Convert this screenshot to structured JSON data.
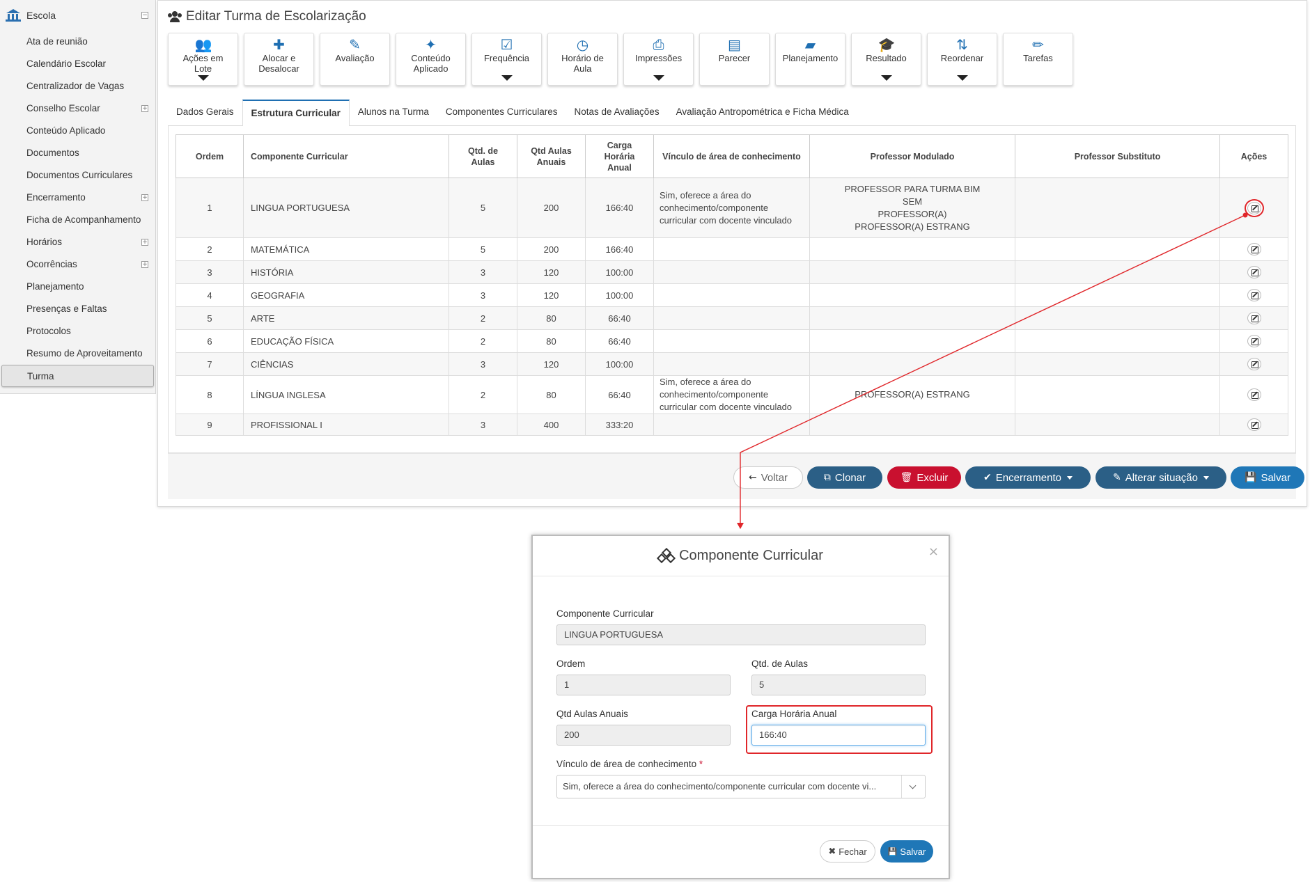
{
  "sidebar": {
    "title": "Escola",
    "items": [
      {
        "label": "Ata de reunião",
        "expandable": false
      },
      {
        "label": "Calendário Escolar",
        "expandable": false
      },
      {
        "label": "Centralizador de Vagas",
        "expandable": false
      },
      {
        "label": "Conselho Escolar",
        "expandable": true
      },
      {
        "label": "Conteúdo Aplicado",
        "expandable": false
      },
      {
        "label": "Documentos",
        "expandable": false
      },
      {
        "label": "Documentos Curriculares",
        "expandable": false
      },
      {
        "label": "Encerramento",
        "expandable": true
      },
      {
        "label": "Ficha de Acompanhamento",
        "expandable": false
      },
      {
        "label": "Horários",
        "expandable": true
      },
      {
        "label": "Ocorrências",
        "expandable": true
      },
      {
        "label": "Planejamento",
        "expandable": false
      },
      {
        "label": "Presenças e Faltas",
        "expandable": false
      },
      {
        "label": "Protocolos",
        "expandable": false
      },
      {
        "label": "Resumo de Aproveitamento",
        "expandable": false
      },
      {
        "label": "Turma",
        "expandable": false,
        "active": true
      }
    ]
  },
  "page": {
    "title": "Editar Turma de Escolarização"
  },
  "toolbar": [
    {
      "l1": "Ações em",
      "l2": "Lote",
      "icon": "users-icon",
      "glyph": "👥",
      "caret": true
    },
    {
      "l1": "Alocar e",
      "l2": "Desalocar",
      "icon": "puzzle-icon",
      "glyph": "✚",
      "caret": false
    },
    {
      "l1": "Avaliação",
      "l2": "",
      "icon": "edit-icon",
      "glyph": "✎",
      "caret": false
    },
    {
      "l1": "Conteúdo",
      "l2": "Aplicado",
      "icon": "magic-wand-icon",
      "glyph": "✦",
      "caret": false
    },
    {
      "l1": "Frequência",
      "l2": "",
      "icon": "check-square-icon",
      "glyph": "☑",
      "caret": true
    },
    {
      "l1": "Horário de",
      "l2": "Aula",
      "icon": "clock-icon",
      "glyph": "◷",
      "caret": false
    },
    {
      "l1": "Impressões",
      "l2": "",
      "icon": "print-icon",
      "glyph": "⎙",
      "caret": true
    },
    {
      "l1": "Parecer",
      "l2": "",
      "icon": "file-text-icon",
      "glyph": "▤",
      "caret": false
    },
    {
      "l1": "Planejamento",
      "l2": "",
      "icon": "book-icon",
      "glyph": "▰",
      "caret": false
    },
    {
      "l1": "Resultado",
      "l2": "",
      "icon": "graduation-cap-icon",
      "glyph": "🎓",
      "caret": true
    },
    {
      "l1": "Reordenar",
      "l2": "",
      "icon": "sort-alpha-icon",
      "glyph": "⇅",
      "caret": true
    },
    {
      "l1": "Tarefas",
      "l2": "",
      "icon": "pencil-icon",
      "glyph": "✏",
      "caret": false
    }
  ],
  "tabs": [
    {
      "label": "Dados Gerais",
      "active": false
    },
    {
      "label": "Estrutura Curricular",
      "active": true
    },
    {
      "label": "Alunos na Turma",
      "active": false
    },
    {
      "label": "Componentes Curriculares",
      "active": false
    },
    {
      "label": "Notas de Avaliações",
      "active": false
    },
    {
      "label": "Avaliação Antropométrica e Ficha Médica",
      "active": false
    }
  ],
  "table": {
    "headers": {
      "ordem": "Ordem",
      "componente": "Componente Curricular",
      "qtd_aulas": "Qtd. de Aulas",
      "qtd_anuais": "Qtd Aulas Anuais",
      "carga": "Carga Horária Anual",
      "vinculo": "Vínculo de área de conhecimento",
      "prof_modulado": "Professor Modulado",
      "prof_substituto": "Professor Substituto",
      "acoes": "Ações"
    },
    "rows": [
      {
        "ordem": "1",
        "componente": "LINGUA PORTUGUESA",
        "qtd": "5",
        "anuais": "200",
        "carga": "166:40",
        "vinculo": "Sim, oferece a área do conhecimento/componente curricular com docente vinculado",
        "prof": "PROFESSOR PARA TURMA BIM\nSEM\nPROFESSOR(A)\nPROFESSOR(A) ESTRANG",
        "sub": ""
      },
      {
        "ordem": "2",
        "componente": "MATEMÁTICA",
        "qtd": "5",
        "anuais": "200",
        "carga": "166:40",
        "vinculo": "",
        "prof": "",
        "sub": ""
      },
      {
        "ordem": "3",
        "componente": "HISTÓRIA",
        "qtd": "3",
        "anuais": "120",
        "carga": "100:00",
        "vinculo": "",
        "prof": "",
        "sub": ""
      },
      {
        "ordem": "4",
        "componente": "GEOGRAFIA",
        "qtd": "3",
        "anuais": "120",
        "carga": "100:00",
        "vinculo": "",
        "prof": "",
        "sub": ""
      },
      {
        "ordem": "5",
        "componente": "ARTE",
        "qtd": "2",
        "anuais": "80",
        "carga": "66:40",
        "vinculo": "",
        "prof": "",
        "sub": ""
      },
      {
        "ordem": "6",
        "componente": "EDUCAÇÃO FÍSICA",
        "qtd": "2",
        "anuais": "80",
        "carga": "66:40",
        "vinculo": "",
        "prof": "",
        "sub": ""
      },
      {
        "ordem": "7",
        "componente": "CIÊNCIAS",
        "qtd": "3",
        "anuais": "120",
        "carga": "100:00",
        "vinculo": "",
        "prof": "",
        "sub": ""
      },
      {
        "ordem": "8",
        "componente": "LÍNGUA INGLESA",
        "qtd": "2",
        "anuais": "80",
        "carga": "66:40",
        "vinculo": "Sim, oferece a área do conhecimento/componente curricular com docente vinculado",
        "prof": "PROFESSOR(A) ESTRANG",
        "sub": ""
      },
      {
        "ordem": "9",
        "componente": "PROFISSIONAL I",
        "qtd": "3",
        "anuais": "400",
        "carga": "333:20",
        "vinculo": "",
        "prof": "",
        "sub": ""
      }
    ]
  },
  "footer": {
    "voltar": "Voltar",
    "clonar": "Clonar",
    "excluir": "Excluir",
    "encerramento": "Encerramento",
    "alterar": "Alterar situação",
    "salvar": "Salvar"
  },
  "modal": {
    "title": "Componente Curricular",
    "close": "×",
    "componente_label": "Componente Curricular",
    "componente_value": "LINGUA PORTUGUESA",
    "ordem_label": "Ordem",
    "ordem_value": "1",
    "qtd_label": "Qtd. de Aulas",
    "qtd_value": "5",
    "anuais_label": "Qtd Aulas Anuais",
    "anuais_value": "200",
    "carga_label": "Carga Horária Anual",
    "carga_value": "166:40",
    "vinculo_label": "Vínculo de área de conhecimento",
    "vinculo_required": "*",
    "vinculo_value": "Sim, oferece a área do conhecimento/componente curricular com docente vi...",
    "fechar": "Fechar",
    "salvar": "Salvar"
  },
  "colors": {
    "primary": "#1f77b7",
    "danger": "#c9102f",
    "dark_blue": "#2b5f86",
    "annotation": "#e0262a"
  }
}
